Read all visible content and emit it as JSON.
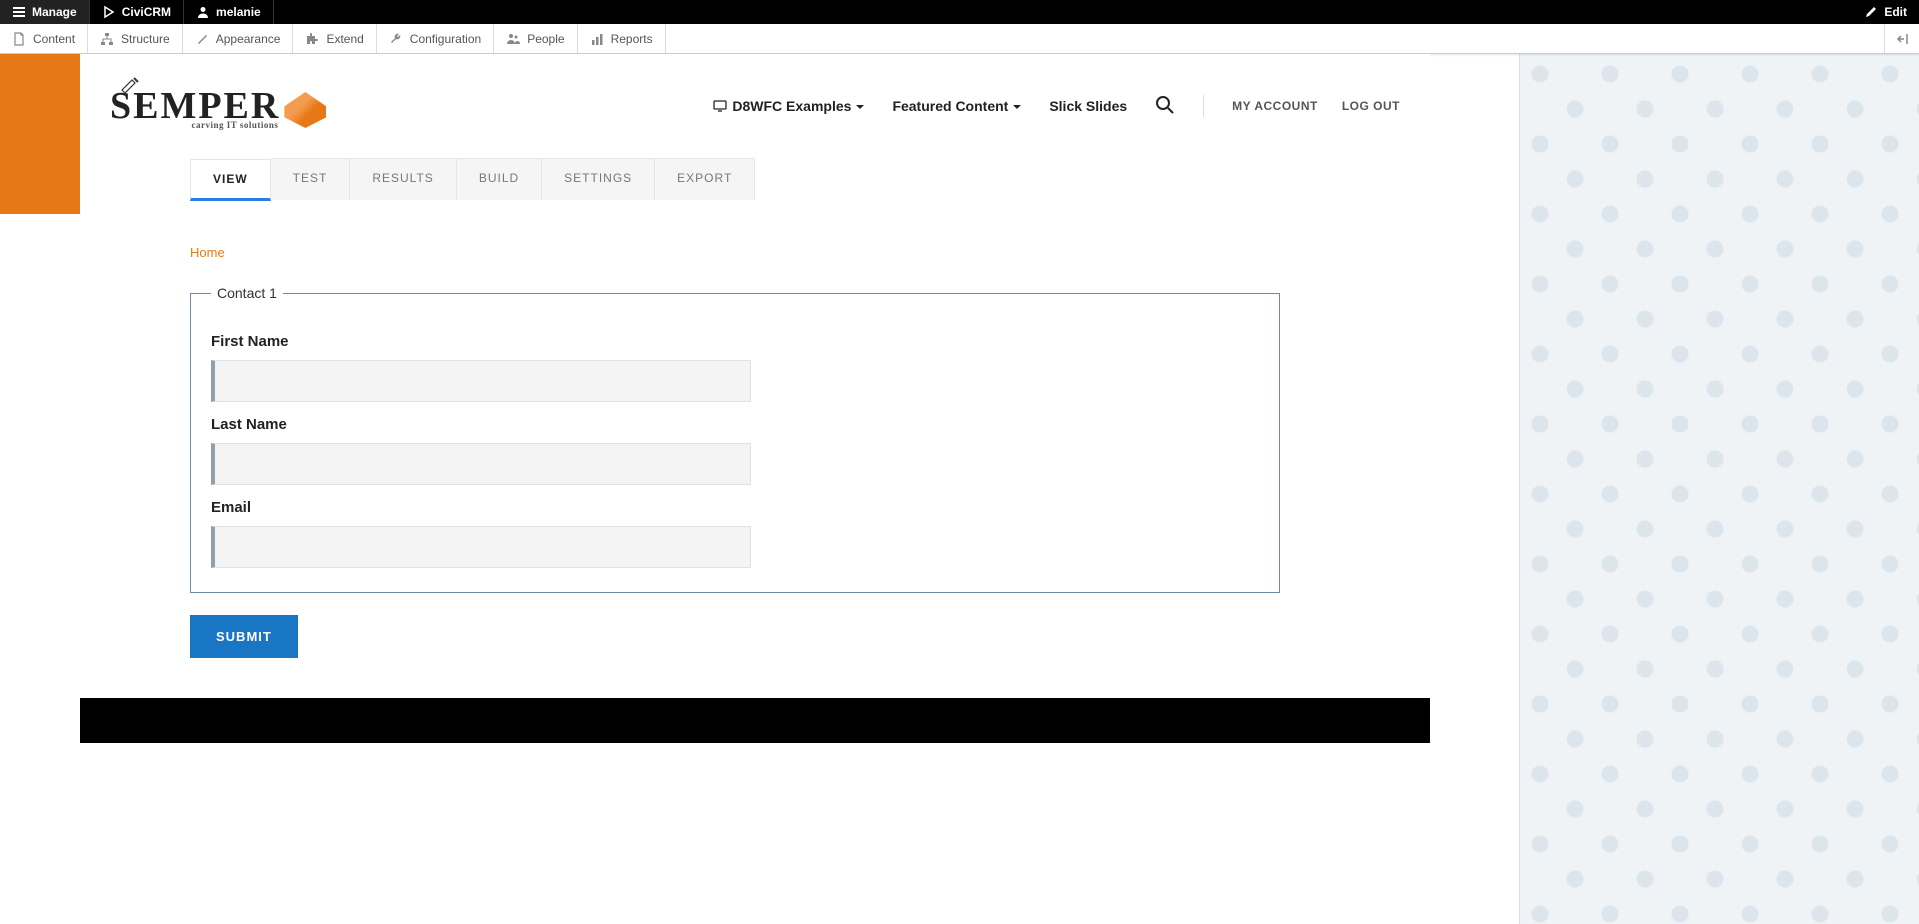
{
  "toolbar": {
    "manage": "Manage",
    "civicrm": "CiviCRM",
    "user": "melanie",
    "edit": "Edit"
  },
  "admin": {
    "content": "Content",
    "structure": "Structure",
    "appearance": "Appearance",
    "extend": "Extend",
    "configuration": "Configuration",
    "people": "People",
    "reports": "Reports"
  },
  "logo": {
    "name": "SEMPER",
    "tagline": "carving IT solutions"
  },
  "nav": {
    "d8wfc": "D8WFC Examples",
    "featured": "Featured Content",
    "slick": "Slick Slides"
  },
  "account": {
    "my_account": "MY ACCOUNT",
    "log_out": "LOG OUT"
  },
  "tabs": {
    "view": "VIEW",
    "test": "TEST",
    "results": "RESULTS",
    "build": "BUILD",
    "settings": "SETTINGS",
    "export": "EXPORT"
  },
  "breadcrumb": {
    "home": "Home"
  },
  "form": {
    "legend": "Contact 1",
    "first_name_label": "First Name",
    "last_name_label": "Last Name",
    "email_label": "Email",
    "submit": "SUBMIT"
  }
}
